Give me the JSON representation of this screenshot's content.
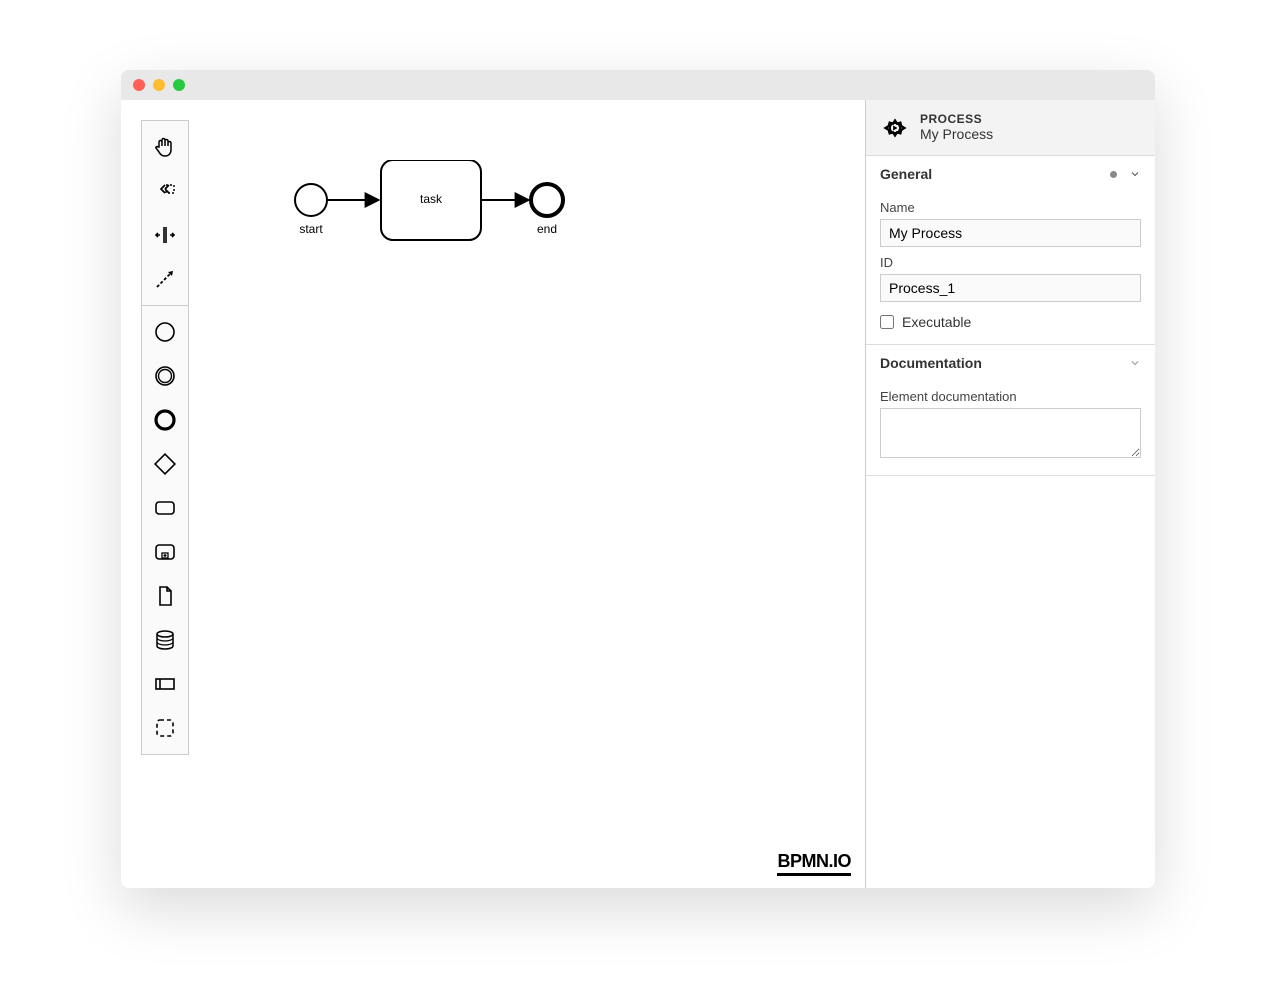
{
  "palette": {
    "items": [
      {
        "name": "hand-tool"
      },
      {
        "name": "lasso-tool"
      },
      {
        "name": "space-tool"
      },
      {
        "name": "connect-tool"
      },
      {
        "name": "start-event"
      },
      {
        "name": "intermediate-event"
      },
      {
        "name": "end-event"
      },
      {
        "name": "gateway"
      },
      {
        "name": "task"
      },
      {
        "name": "subprocess"
      },
      {
        "name": "data-object"
      },
      {
        "name": "data-store"
      },
      {
        "name": "participant"
      },
      {
        "name": "group"
      }
    ]
  },
  "diagram": {
    "startLabel": "start",
    "taskLabel": "task",
    "endLabel": "end"
  },
  "watermark": "BPMN.IO",
  "props": {
    "header": {
      "type": "PROCESS",
      "name": "My Process"
    },
    "general": {
      "title": "General",
      "nameLabel": "Name",
      "nameValue": "My Process",
      "idLabel": "ID",
      "idValue": "Process_1",
      "executableLabel": "Executable",
      "executable": false
    },
    "documentation": {
      "title": "Documentation",
      "label": "Element documentation",
      "value": ""
    }
  }
}
